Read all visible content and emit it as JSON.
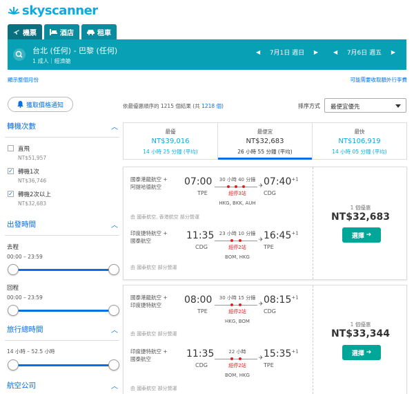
{
  "brand": "skyscanner",
  "tabs": [
    {
      "label": "機票",
      "icon": "plane-icon",
      "active": true
    },
    {
      "label": "酒店",
      "icon": "bed-icon",
      "active": false
    },
    {
      "label": "租車",
      "icon": "car-icon",
      "active": false
    }
  ],
  "search": {
    "route": "台北 (任何) - 巴黎 (任何)",
    "passengers": "1 成人｜經濟艙",
    "depart_date": "7月1日 週日",
    "return_date": "7月6日 週五"
  },
  "links": {
    "full_month": "顯示整個月份",
    "fees": "可能需要收取額外行李費"
  },
  "price_alert": "獲取價格通知",
  "filters": {
    "stops": {
      "title": "轉機次數",
      "options": [
        {
          "label": "直飛",
          "price": "NT$51,957",
          "checked": false
        },
        {
          "label": "轉機1次",
          "price": "NT$36,746",
          "checked": true
        },
        {
          "label": "轉機2次以上",
          "price": "NT$32,683",
          "checked": true
        }
      ]
    },
    "times": {
      "title": "出發時間",
      "outbound_label": "去程",
      "outbound_range": "00:00 – 23:59",
      "return_label": "回程",
      "return_range": "00:00 – 23:59"
    },
    "duration": {
      "title": "旅行總時間",
      "range": "14 小時 – 52.5 小時"
    },
    "airlines": {
      "title": "航空公司"
    }
  },
  "results": {
    "count_text": "依最優惠順序的 1215 個結果 (共",
    "count_total": "1218 個",
    "count_close": ")",
    "sort_label": "排序方式",
    "sort_value": "最便宜優先"
  },
  "summary": [
    {
      "title": "最優",
      "price": "NT$39,016",
      "duration": "14 小時 25 分鐘 (平均)",
      "active": false
    },
    {
      "title": "最便宜",
      "price": "NT$32,683",
      "duration": "26 小時 55 分鐘 (平均)",
      "active": true
    },
    {
      "title": "最快",
      "price": "NT$106,919",
      "duration": "14 小時 05 分鐘 (平均)",
      "active": false
    }
  ],
  "cards": [
    {
      "deal_label": "1 個優惠",
      "price": "NT$32,683",
      "select_label": "選擇",
      "legs": [
        {
          "airline_1": "國泰港龍航空 +",
          "airline_2": "阿提哈德航空",
          "dep_time": "07:00",
          "dep_code": "TPE",
          "duration": "30 小時 40 分鐘",
          "stops": "經停3站",
          "via": "HKG, BKK, AUH",
          "arr_time": "07:40",
          "arr_offset": "+1",
          "arr_code": "CDG",
          "note": "由 國泰航空, 香港航空 部分營運"
        },
        {
          "airline_1": "印度捷特航空 +",
          "airline_2": "國泰航空",
          "dep_time": "11:35",
          "dep_code": "CDG",
          "duration": "23 小時 10 分鐘",
          "stops": "經停2站",
          "via": "BOM, HKG",
          "arr_time": "16:45",
          "arr_offset": "+1",
          "arr_code": "TPE",
          "note": "由 國泰航空 部分營運"
        }
      ]
    },
    {
      "deal_label": "1 個優惠",
      "price": "NT$33,344",
      "select_label": "選擇",
      "legs": [
        {
          "airline_1": "國泰港龍航空 +",
          "airline_2": "印度捷特航空",
          "dep_time": "08:00",
          "dep_code": "TPE",
          "duration": "30 小時 15 分鐘",
          "stops": "經停2站",
          "via": "HKG, BOM",
          "arr_time": "08:15",
          "arr_offset": "+1",
          "arr_code": "CDG",
          "note": "由 國泰航空 部分營運"
        },
        {
          "airline_1": "印度捷特航空 +",
          "airline_2": "國泰航空",
          "dep_time": "11:35",
          "dep_code": "CDG",
          "duration": "22 小時",
          "stops": "經停2站",
          "via": "BOM, HKG",
          "arr_time": "15:35",
          "arr_offset": "+1",
          "arr_code": "TPE",
          "note": "由 國泰航空 部分營運"
        }
      ]
    }
  ],
  "colors": {
    "accent": "#0770e3",
    "brand": "#0aabe1",
    "header": "#08a0b4",
    "select": "#00a698",
    "stop_red": "#e01e1e"
  }
}
